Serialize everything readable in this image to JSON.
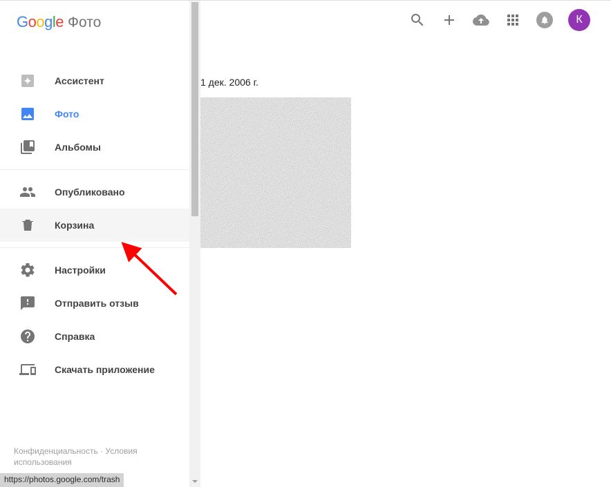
{
  "product_name": "Фото",
  "sidebar": {
    "items": [
      {
        "label": "Ассистент"
      },
      {
        "label": "Фото"
      },
      {
        "label": "Альбомы"
      },
      {
        "label": "Опубликовано"
      },
      {
        "label": "Корзина"
      },
      {
        "label": "Настройки"
      },
      {
        "label": "Отправить отзыв"
      },
      {
        "label": "Справка"
      },
      {
        "label": "Скачать приложение"
      }
    ]
  },
  "footer": {
    "privacy": "Конфиденциальность",
    "terms": "Условия использования",
    "sep": " · "
  },
  "main": {
    "date_header": "1 дек. 2006 г."
  },
  "avatar_initial": "К",
  "status_url": "https://photos.google.com/trash"
}
